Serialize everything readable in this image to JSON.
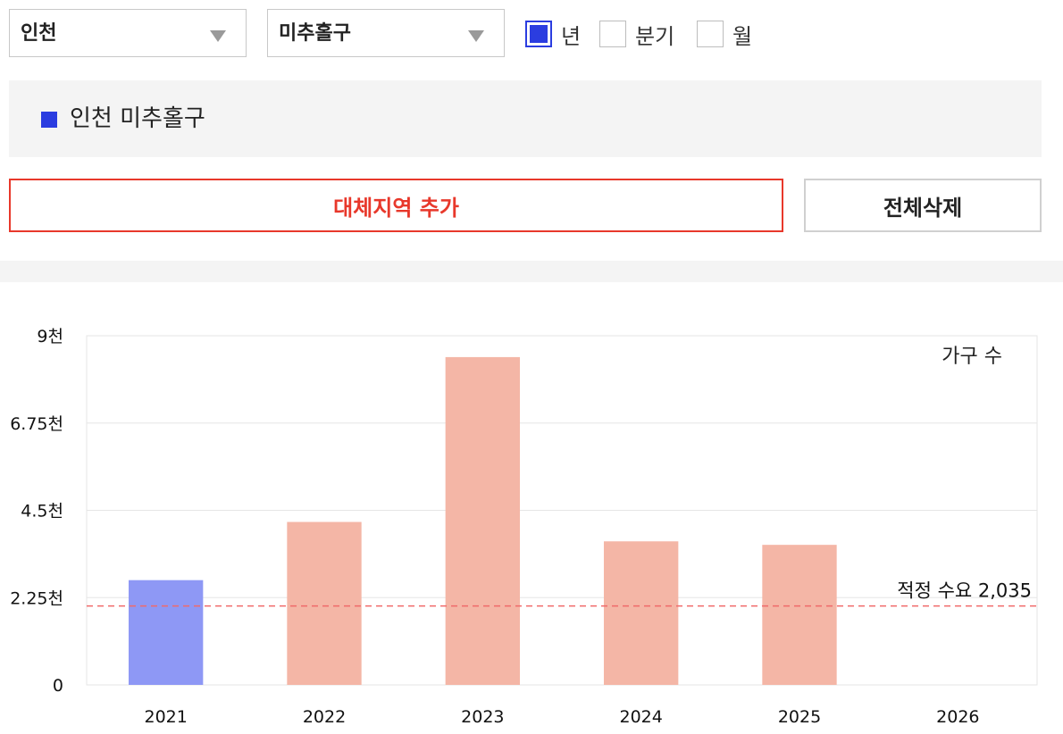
{
  "filters": {
    "region": "인천",
    "district": "미추홀구",
    "period_options": [
      {
        "label": "년",
        "checked": true
      },
      {
        "label": "분기",
        "checked": false
      },
      {
        "label": "월",
        "checked": false
      }
    ]
  },
  "legend": {
    "label": "인천 미추홀구",
    "color": "#2b3de0"
  },
  "buttons": {
    "add_region": "대체지역 추가",
    "delete_all": "전체삭제"
  },
  "chart_data": {
    "type": "bar",
    "categories": [
      "2021",
      "2022",
      "2023",
      "2024",
      "2025",
      "2026"
    ],
    "series": [
      {
        "values": [
          2700,
          4200,
          8450,
          3700,
          3610,
          0
        ]
      }
    ],
    "ylabel": "가구 수",
    "ylim": [
      0,
      9000
    ],
    "yticks": [
      0,
      2250,
      4500,
      6750,
      9000
    ],
    "ytick_labels": [
      "0",
      "2.25천",
      "4.5천",
      "6.75천",
      "9천"
    ],
    "reference_line": {
      "label": "적정 수요 2,035",
      "value": 2035,
      "color": "#f06a6a"
    },
    "colors": {
      "current_year": "#8e98f5",
      "other_years": "#f4b6a6"
    },
    "highlight_index": 0,
    "grid": true
  }
}
